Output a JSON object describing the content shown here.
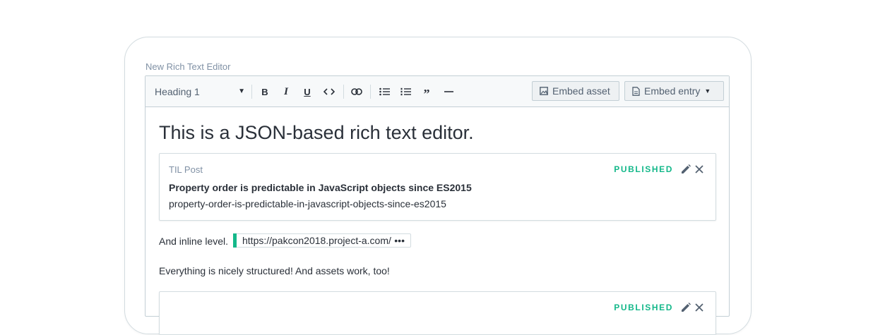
{
  "field": {
    "label": "New Rich Text Editor"
  },
  "toolbar": {
    "heading_select": "Heading 1",
    "embed_asset_label": "Embed asset",
    "embed_entry_label": "Embed entry"
  },
  "document": {
    "heading": "This is a JSON-based rich text editor.",
    "entry_card": {
      "type": "TIL Post",
      "status": "PUBLISHED",
      "title": "Property order is predictable in JavaScript objects since ES2015",
      "slug": "property-order-is-predictable-in-javascript-objects-since-es2015"
    },
    "paragraph_1": "And inline level.",
    "inline_entry": {
      "url": "https://pakcon2018.project-a.com/",
      "more": "•••"
    },
    "paragraph_2": "Everything is nicely structured! And assets work, too!",
    "asset_card": {
      "status": "PUBLISHED"
    }
  },
  "colors": {
    "accent_green": "#14b88a",
    "text": "#2a3039",
    "muted": "#8091a5",
    "border": "#c3cfd5",
    "toolbar_bg": "#f7f9fa"
  }
}
